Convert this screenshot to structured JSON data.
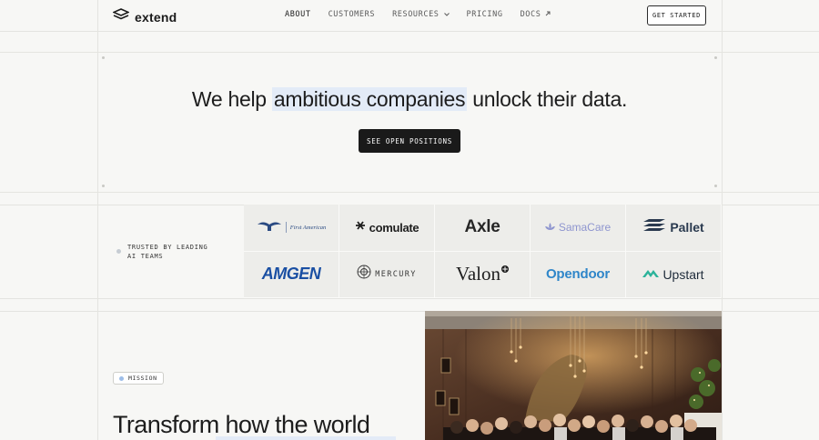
{
  "nav": {
    "brand": "extend",
    "items": [
      {
        "label": "ABOUT"
      },
      {
        "label": "CUSTOMERS"
      },
      {
        "label": "RESOURCES"
      },
      {
        "label": "PRICING"
      },
      {
        "label": "DOCS"
      }
    ],
    "cta": "GET STARTED"
  },
  "hero": {
    "title_before": "We help ",
    "title_highlight": "ambitious companies",
    "title_after": " unlock their data.",
    "button": "SEE OPEN POSITIONS"
  },
  "trusted": {
    "label": "TRUSTED BY LEADING AI TEAMS",
    "logos": [
      {
        "name": "First American"
      },
      {
        "name": "comulate"
      },
      {
        "name": "Axle"
      },
      {
        "name": "SamaCare"
      },
      {
        "name": "Pallet"
      },
      {
        "name": "AMGEN"
      },
      {
        "name": "MERCURY"
      },
      {
        "name": "Valon"
      },
      {
        "name": "Opendoor"
      },
      {
        "name": "Upstart"
      }
    ]
  },
  "mission": {
    "badge": "MISSION",
    "title": "Transform how the world"
  },
  "colors": {
    "background": "#f7f7f5",
    "highlight": "#e3ebf7",
    "dark_button": "#1a1a1a"
  }
}
